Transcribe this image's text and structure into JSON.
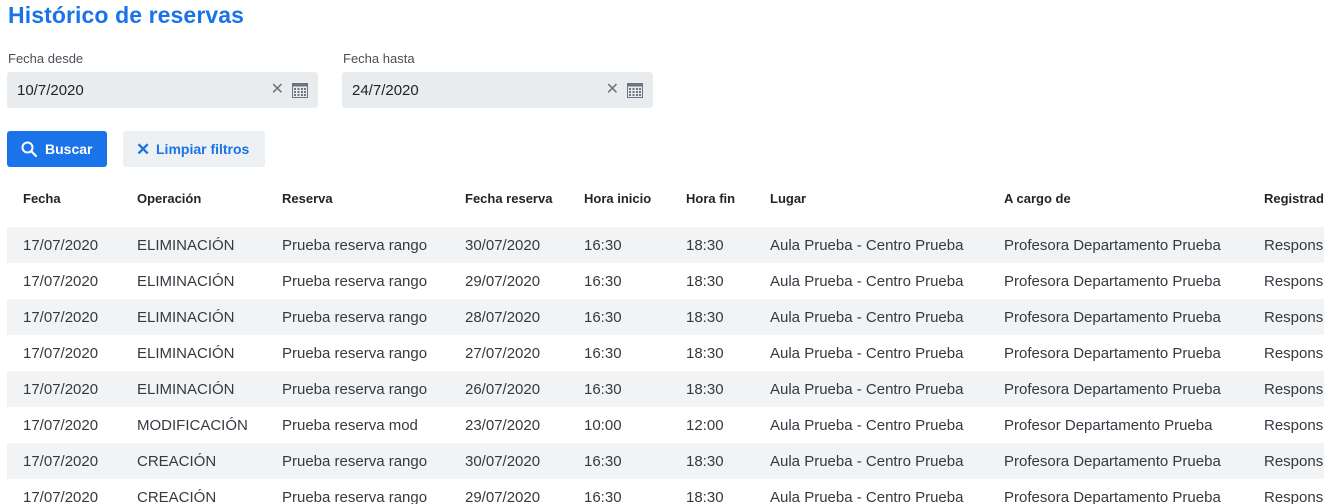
{
  "page": {
    "title": "Histórico de reservas"
  },
  "filters": {
    "from": {
      "label": "Fecha desde",
      "value": "10/7/2020"
    },
    "to": {
      "label": "Fecha hasta",
      "value": "24/7/2020"
    },
    "clear_glyph": "✕"
  },
  "actions": {
    "search_label": "Buscar",
    "clear_label": "Limpiar filtros",
    "clear_glyph": "✕"
  },
  "colors": {
    "accent": "#1a73e8",
    "row_alt": "#f1f3f5",
    "input_bg": "#e9ecef"
  },
  "table": {
    "columns": [
      "Fecha",
      "Operación",
      "Reserva",
      "Fecha reserva",
      "Hora inicio",
      "Hora fin",
      "Lugar",
      "A cargo de",
      "Registrado"
    ],
    "rows": [
      [
        "17/07/2020",
        "ELIMINACIÓN",
        "Prueba reserva rango",
        "30/07/2020",
        "16:30",
        "18:30",
        "Aula Prueba - Centro Prueba",
        "Profesora Departamento Prueba",
        "Responsable"
      ],
      [
        "17/07/2020",
        "ELIMINACIÓN",
        "Prueba reserva rango",
        "29/07/2020",
        "16:30",
        "18:30",
        "Aula Prueba - Centro Prueba",
        "Profesora Departamento Prueba",
        "Responsable"
      ],
      [
        "17/07/2020",
        "ELIMINACIÓN",
        "Prueba reserva rango",
        "28/07/2020",
        "16:30",
        "18:30",
        "Aula Prueba - Centro Prueba",
        "Profesora Departamento Prueba",
        "Responsable"
      ],
      [
        "17/07/2020",
        "ELIMINACIÓN",
        "Prueba reserva rango",
        "27/07/2020",
        "16:30",
        "18:30",
        "Aula Prueba - Centro Prueba",
        "Profesora Departamento Prueba",
        "Responsable"
      ],
      [
        "17/07/2020",
        "ELIMINACIÓN",
        "Prueba reserva rango",
        "26/07/2020",
        "16:30",
        "18:30",
        "Aula Prueba - Centro Prueba",
        "Profesora Departamento Prueba",
        "Responsable"
      ],
      [
        "17/07/2020",
        "MODIFICACIÓN",
        "Prueba reserva mod",
        "23/07/2020",
        "10:00",
        "12:00",
        "Aula Prueba - Centro Prueba",
        "Profesor Departamento Prueba",
        "Responsable"
      ],
      [
        "17/07/2020",
        "CREACIÓN",
        "Prueba reserva rango",
        "30/07/2020",
        "16:30",
        "18:30",
        "Aula Prueba - Centro Prueba",
        "Profesora Departamento Prueba",
        "Responsable"
      ],
      [
        "17/07/2020",
        "CREACIÓN",
        "Prueba reserva rango",
        "29/07/2020",
        "16:30",
        "18:30",
        "Aula Prueba - Centro Prueba",
        "Profesora Departamento Prueba",
        "Responsable"
      ]
    ]
  }
}
